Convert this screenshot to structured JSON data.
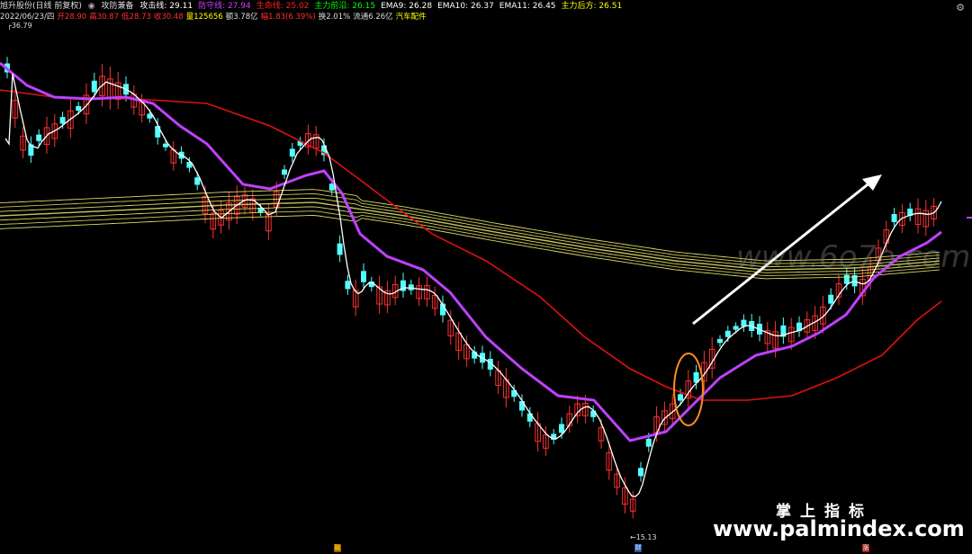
{
  "header": {
    "stock_name": "旭升股份(日线 前复权)",
    "indicator_name": "攻防兼备",
    "lines": [
      {
        "label": "攻击线: 29.11",
        "color": "#ffffff"
      },
      {
        "label": "防守线: 27.94",
        "color": "#d040ff"
      },
      {
        "label": "生命线: 25.02",
        "color": "#ff2020"
      },
      {
        "label": "主力前沿: 26.15",
        "color": "#00ff00"
      },
      {
        "label": "EMA9: 26.28",
        "color": "#ffffff"
      },
      {
        "label": "EMA10: 26.37",
        "color": "#ffffff"
      },
      {
        "label": "EMA11: 26.45",
        "color": "#ffffff"
      },
      {
        "label": "主力后方: 26.51",
        "color": "#ffff00"
      }
    ],
    "quote": [
      {
        "label": "2022/06/23/四",
        "color": "#dddddd"
      },
      {
        "label": "开28.90",
        "color": "#ff3030"
      },
      {
        "label": "高30.87",
        "color": "#ff3030"
      },
      {
        "label": "低28.73",
        "color": "#ff3030"
      },
      {
        "label": "收30.48",
        "color": "#ff3030"
      },
      {
        "label": "量125656",
        "color": "#ffff00"
      },
      {
        "label": "额3.78亿",
        "color": "#dddddd"
      },
      {
        "label": "幅1.83(6.39%)",
        "color": "#ff3030"
      },
      {
        "label": "换2.01%",
        "color": "#dddddd"
      },
      {
        "label": "流通6.26亿",
        "color": "#dddddd"
      },
      {
        "label": "汽车配件",
        "color": "#ffff00"
      }
    ],
    "settings_icon": "gear-icon"
  },
  "price_labels": {
    "high": "36.79",
    "low": "15.13"
  },
  "event_markers": [
    "融",
    "财",
    "涨"
  ],
  "watermarks": {
    "cn": "掌上指标",
    "url": "www.palmindex.com",
    "faint": "www.6o7o.com"
  },
  "colors": {
    "up": "#ff3030",
    "down": "#54ffff",
    "attack_line": "#ffffff",
    "defense_line": "#c040ff",
    "life_line": "#e01010",
    "ribbon": "#ffff60",
    "highlight_ellipse": "#ff8c20",
    "arrow": "#ffffff"
  }
}
